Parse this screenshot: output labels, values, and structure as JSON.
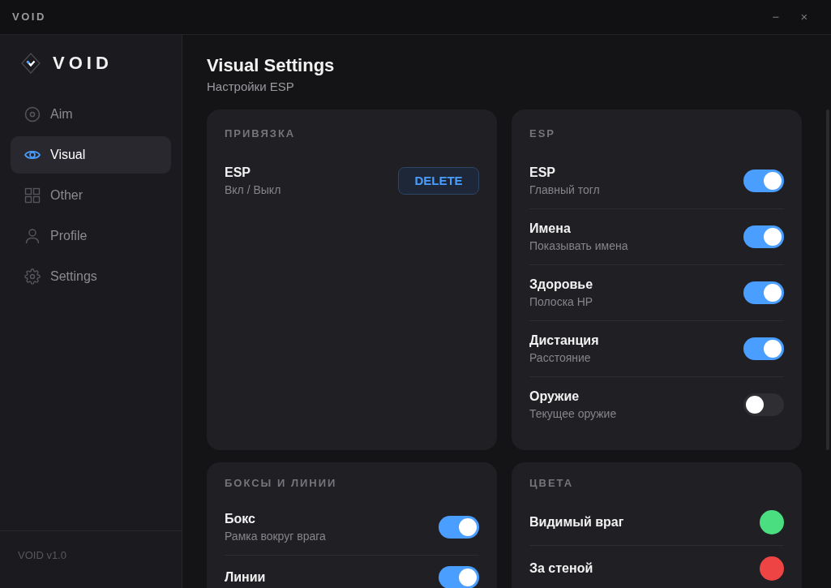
{
  "window": {
    "title": "VOID",
    "controls": [
      "−",
      "×"
    ]
  },
  "sidebar": {
    "logo": "VOID",
    "items": [
      {
        "label": "Aim",
        "selected": false
      },
      {
        "label": "Visual",
        "selected": true
      },
      {
        "label": "Other",
        "selected": false
      },
      {
        "label": "Profile",
        "selected": false
      },
      {
        "label": "Settings",
        "selected": false
      }
    ],
    "footer": "VOID v1.0"
  },
  "page": {
    "title": "Visual Settings",
    "subtitle": "Настройки ESP"
  },
  "cards": [
    {
      "title": "ПРИВЯЗКА",
      "rows": [
        {
          "kind": "bind",
          "label": "ESP",
          "description": "Вкл / Выкл",
          "button": "DELETE"
        }
      ]
    },
    {
      "title": "ESP",
      "rows": [
        {
          "kind": "toggle",
          "label": "ESP",
          "description": "Главный тогл",
          "on": true
        },
        {
          "kind": "toggle",
          "label": "Имена",
          "description": "Показывать имена",
          "on": true
        },
        {
          "kind": "toggle",
          "label": "Здоровье",
          "description": "Полоска HP",
          "on": true
        },
        {
          "kind": "toggle",
          "label": "Дистанция",
          "description": "Расстояние",
          "on": true
        },
        {
          "kind": "toggle",
          "label": "Оружие",
          "description": "Текущее оружие",
          "on": false
        }
      ]
    },
    {
      "title": "БОКСЫ И ЛИНИИ",
      "rows": [
        {
          "kind": "toggle",
          "label": "Бокс",
          "description": "Рамка вокруг врага",
          "on": true
        },
        {
          "kind": "toggle",
          "label": "Линии",
          "on": true
        }
      ]
    },
    {
      "title": "ЦВЕТА",
      "rows": [
        {
          "kind": "color",
          "label": "Видимый враг",
          "color": "#4ade80"
        },
        {
          "kind": "color",
          "label": "За стеной",
          "color": "#ef4444"
        }
      ]
    }
  ]
}
